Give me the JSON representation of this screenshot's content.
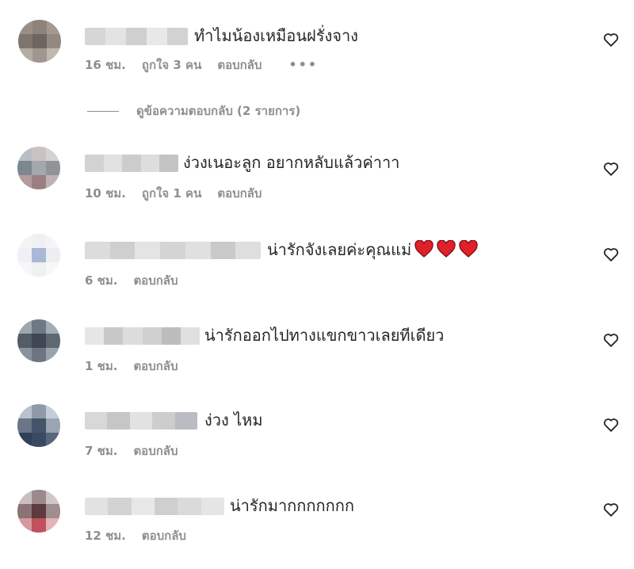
{
  "comments": [
    {
      "text": "ทำไมน้องเหมือนฝรั่งจาง",
      "time": "16 ชม.",
      "likes": "ถูกใจ 3 คน",
      "reply": "ตอบกลับ",
      "more": "•••",
      "emoji_hearts": 0
    },
    {
      "text": "ง่วงเนอะลูก อยากหลับแล้วค่าาา",
      "time": "10 ชม.",
      "likes": "ถูกใจ 1 คน",
      "reply": "ตอบกลับ",
      "emoji_hearts": 0
    },
    {
      "text": "น่ารักจังเลยค่ะคุณแม่",
      "time": "6 ชม.",
      "reply": "ตอบกลับ",
      "emoji_hearts": 3
    },
    {
      "text": "น่ารักออกไปทางแขกขาวเลยทีเดียว",
      "time": "1 ชม.",
      "reply": "ตอบกลับ",
      "emoji_hearts": 0
    },
    {
      "text": "ง่วง ไหม",
      "time": "7 ชม.",
      "reply": "ตอบกลับ",
      "emoji_hearts": 0
    },
    {
      "text": "น่ารักมากกกกกกก",
      "time": "12 ชม.",
      "reply": "ตอบกลับ",
      "emoji_hearts": 0
    }
  ],
  "view_replies": "ดูข้อความตอบกลับ (2 รายการ)",
  "colors": {
    "text": "#262626",
    "meta": "#8e8e8e",
    "emoji_heart": "#e0202a"
  },
  "icons": {
    "like": "heart-outline-icon",
    "emoji": "red-heart-emoji"
  }
}
